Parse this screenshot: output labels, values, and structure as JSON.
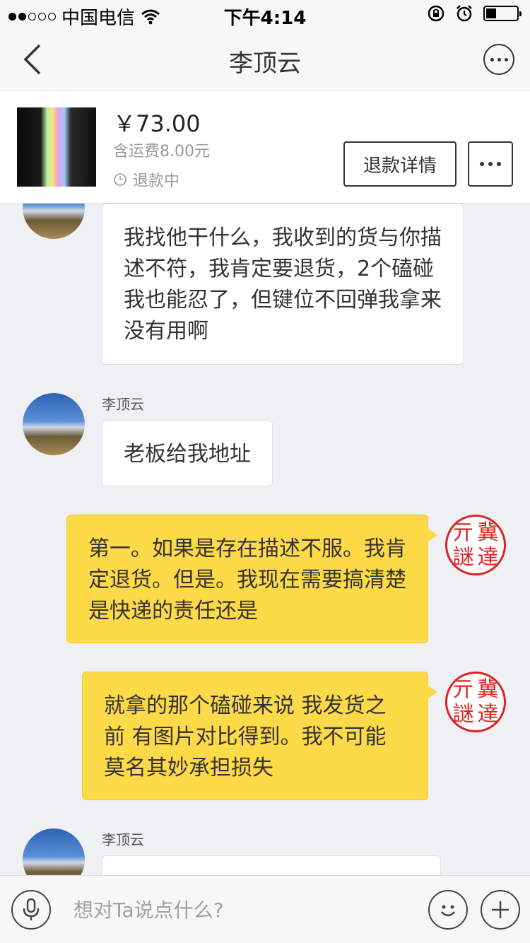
{
  "status_bar": {
    "carrier": "中国电信",
    "time": "下午4:14"
  },
  "nav": {
    "title": "李顶云"
  },
  "order": {
    "price": "￥73.00",
    "shipping": "含运费8.00元",
    "status": "退款中",
    "refund_button": "退款详情"
  },
  "messages": [
    {
      "from": "other",
      "text": "我找他干什么，我收到的货与你描述不符，我肯定要退货，2个磕碰我也能忍了，但键位不回弹我拿来没有用啊"
    },
    {
      "from": "other",
      "sender": "李顶云",
      "text": "老板给我地址"
    },
    {
      "from": "me",
      "text": "第一。如果是存在描述不服。我肯定退货。但是。我现在需要搞清楚是快递的责任还是"
    },
    {
      "from": "me",
      "text": "就拿的那个磕碰来说 我发货之前 有图片对比得到。我不可能莫名其妙承担损失"
    },
    {
      "from": "other",
      "sender": "李顶云",
      "text": ""
    }
  ],
  "input": {
    "placeholder": "想对Ta说点什么?"
  },
  "seal_chars": [
    "亓",
    "冀",
    "謎",
    "達"
  ]
}
